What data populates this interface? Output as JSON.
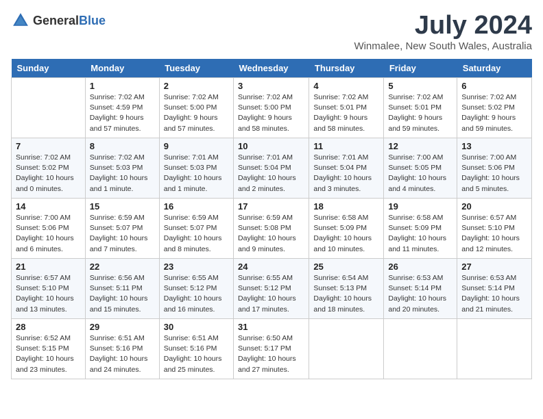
{
  "logo": {
    "text_general": "General",
    "text_blue": "Blue"
  },
  "title": "July 2024",
  "subtitle": "Winmalee, New South Wales, Australia",
  "weekdays": [
    "Sunday",
    "Monday",
    "Tuesday",
    "Wednesday",
    "Thursday",
    "Friday",
    "Saturday"
  ],
  "weeks": [
    [
      {
        "day": "",
        "sunrise": "",
        "sunset": "",
        "daylight": ""
      },
      {
        "day": "1",
        "sunrise": "Sunrise: 7:02 AM",
        "sunset": "Sunset: 4:59 PM",
        "daylight": "Daylight: 9 hours and 57 minutes."
      },
      {
        "day": "2",
        "sunrise": "Sunrise: 7:02 AM",
        "sunset": "Sunset: 5:00 PM",
        "daylight": "Daylight: 9 hours and 57 minutes."
      },
      {
        "day": "3",
        "sunrise": "Sunrise: 7:02 AM",
        "sunset": "Sunset: 5:00 PM",
        "daylight": "Daylight: 9 hours and 58 minutes."
      },
      {
        "day": "4",
        "sunrise": "Sunrise: 7:02 AM",
        "sunset": "Sunset: 5:01 PM",
        "daylight": "Daylight: 9 hours and 58 minutes."
      },
      {
        "day": "5",
        "sunrise": "Sunrise: 7:02 AM",
        "sunset": "Sunset: 5:01 PM",
        "daylight": "Daylight: 9 hours and 59 minutes."
      },
      {
        "day": "6",
        "sunrise": "Sunrise: 7:02 AM",
        "sunset": "Sunset: 5:02 PM",
        "daylight": "Daylight: 9 hours and 59 minutes."
      }
    ],
    [
      {
        "day": "7",
        "sunrise": "Sunrise: 7:02 AM",
        "sunset": "Sunset: 5:02 PM",
        "daylight": "Daylight: 10 hours and 0 minutes."
      },
      {
        "day": "8",
        "sunrise": "Sunrise: 7:02 AM",
        "sunset": "Sunset: 5:03 PM",
        "daylight": "Daylight: 10 hours and 1 minute."
      },
      {
        "day": "9",
        "sunrise": "Sunrise: 7:01 AM",
        "sunset": "Sunset: 5:03 PM",
        "daylight": "Daylight: 10 hours and 1 minute."
      },
      {
        "day": "10",
        "sunrise": "Sunrise: 7:01 AM",
        "sunset": "Sunset: 5:04 PM",
        "daylight": "Daylight: 10 hours and 2 minutes."
      },
      {
        "day": "11",
        "sunrise": "Sunrise: 7:01 AM",
        "sunset": "Sunset: 5:04 PM",
        "daylight": "Daylight: 10 hours and 3 minutes."
      },
      {
        "day": "12",
        "sunrise": "Sunrise: 7:00 AM",
        "sunset": "Sunset: 5:05 PM",
        "daylight": "Daylight: 10 hours and 4 minutes."
      },
      {
        "day": "13",
        "sunrise": "Sunrise: 7:00 AM",
        "sunset": "Sunset: 5:06 PM",
        "daylight": "Daylight: 10 hours and 5 minutes."
      }
    ],
    [
      {
        "day": "14",
        "sunrise": "Sunrise: 7:00 AM",
        "sunset": "Sunset: 5:06 PM",
        "daylight": "Daylight: 10 hours and 6 minutes."
      },
      {
        "day": "15",
        "sunrise": "Sunrise: 6:59 AM",
        "sunset": "Sunset: 5:07 PM",
        "daylight": "Daylight: 10 hours and 7 minutes."
      },
      {
        "day": "16",
        "sunrise": "Sunrise: 6:59 AM",
        "sunset": "Sunset: 5:07 PM",
        "daylight": "Daylight: 10 hours and 8 minutes."
      },
      {
        "day": "17",
        "sunrise": "Sunrise: 6:59 AM",
        "sunset": "Sunset: 5:08 PM",
        "daylight": "Daylight: 10 hours and 9 minutes."
      },
      {
        "day": "18",
        "sunrise": "Sunrise: 6:58 AM",
        "sunset": "Sunset: 5:09 PM",
        "daylight": "Daylight: 10 hours and 10 minutes."
      },
      {
        "day": "19",
        "sunrise": "Sunrise: 6:58 AM",
        "sunset": "Sunset: 5:09 PM",
        "daylight": "Daylight: 10 hours and 11 minutes."
      },
      {
        "day": "20",
        "sunrise": "Sunrise: 6:57 AM",
        "sunset": "Sunset: 5:10 PM",
        "daylight": "Daylight: 10 hours and 12 minutes."
      }
    ],
    [
      {
        "day": "21",
        "sunrise": "Sunrise: 6:57 AM",
        "sunset": "Sunset: 5:10 PM",
        "daylight": "Daylight: 10 hours and 13 minutes."
      },
      {
        "day": "22",
        "sunrise": "Sunrise: 6:56 AM",
        "sunset": "Sunset: 5:11 PM",
        "daylight": "Daylight: 10 hours and 15 minutes."
      },
      {
        "day": "23",
        "sunrise": "Sunrise: 6:55 AM",
        "sunset": "Sunset: 5:12 PM",
        "daylight": "Daylight: 10 hours and 16 minutes."
      },
      {
        "day": "24",
        "sunrise": "Sunrise: 6:55 AM",
        "sunset": "Sunset: 5:12 PM",
        "daylight": "Daylight: 10 hours and 17 minutes."
      },
      {
        "day": "25",
        "sunrise": "Sunrise: 6:54 AM",
        "sunset": "Sunset: 5:13 PM",
        "daylight": "Daylight: 10 hours and 18 minutes."
      },
      {
        "day": "26",
        "sunrise": "Sunrise: 6:53 AM",
        "sunset": "Sunset: 5:14 PM",
        "daylight": "Daylight: 10 hours and 20 minutes."
      },
      {
        "day": "27",
        "sunrise": "Sunrise: 6:53 AM",
        "sunset": "Sunset: 5:14 PM",
        "daylight": "Daylight: 10 hours and 21 minutes."
      }
    ],
    [
      {
        "day": "28",
        "sunrise": "Sunrise: 6:52 AM",
        "sunset": "Sunset: 5:15 PM",
        "daylight": "Daylight: 10 hours and 23 minutes."
      },
      {
        "day": "29",
        "sunrise": "Sunrise: 6:51 AM",
        "sunset": "Sunset: 5:16 PM",
        "daylight": "Daylight: 10 hours and 24 minutes."
      },
      {
        "day": "30",
        "sunrise": "Sunrise: 6:51 AM",
        "sunset": "Sunset: 5:16 PM",
        "daylight": "Daylight: 10 hours and 25 minutes."
      },
      {
        "day": "31",
        "sunrise": "Sunrise: 6:50 AM",
        "sunset": "Sunset: 5:17 PM",
        "daylight": "Daylight: 10 hours and 27 minutes."
      },
      {
        "day": "",
        "sunrise": "",
        "sunset": "",
        "daylight": ""
      },
      {
        "day": "",
        "sunrise": "",
        "sunset": "",
        "daylight": ""
      },
      {
        "day": "",
        "sunrise": "",
        "sunset": "",
        "daylight": ""
      }
    ]
  ]
}
